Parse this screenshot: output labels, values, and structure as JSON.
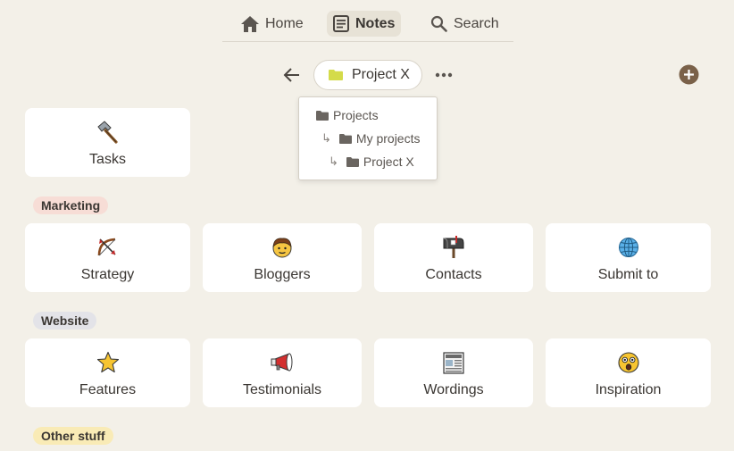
{
  "nav": {
    "home": "Home",
    "notes": "Notes",
    "search": "Search"
  },
  "folder": {
    "current": "Project X",
    "folder_color": "#d4db4a"
  },
  "breadcrumb_menu": {
    "items": [
      {
        "label": "Projects",
        "depth": 0
      },
      {
        "label": "My projects",
        "depth": 1
      },
      {
        "label": "Project X",
        "depth": 2
      }
    ]
  },
  "pinned": {
    "tasks": "Tasks"
  },
  "sections": [
    {
      "name": "Marketing",
      "tag_color": "#f7ddd6",
      "items": [
        {
          "label": "Strategy",
          "icon": "bow-and-arrow-icon"
        },
        {
          "label": "Bloggers",
          "icon": "person-face-icon"
        },
        {
          "label": "Contacts",
          "icon": "mailbox-icon"
        },
        {
          "label": "Submit to",
          "icon": "globe-icon"
        }
      ]
    },
    {
      "name": "Website",
      "tag_color": "#e3e3e8",
      "items": [
        {
          "label": "Features",
          "icon": "star-icon"
        },
        {
          "label": "Testimonials",
          "icon": "megaphone-icon"
        },
        {
          "label": "Wordings",
          "icon": "newspaper-icon"
        },
        {
          "label": "Inspiration",
          "icon": "astonished-face-icon"
        }
      ]
    },
    {
      "name": "Other stuff",
      "tag_color": "#f9ebb6",
      "items": []
    }
  ],
  "colors": {
    "background": "#f3f0e8",
    "accent": "#7a6149"
  }
}
